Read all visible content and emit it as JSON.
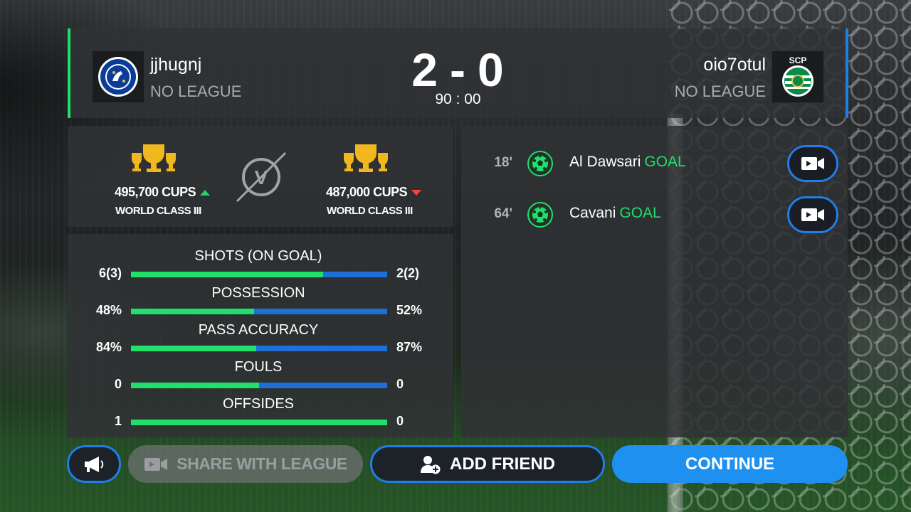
{
  "header": {
    "home": {
      "name": "jjhugnj",
      "league": "NO LEAGUE",
      "crest": "chelsea-crest"
    },
    "away": {
      "name": "oio7otul",
      "league": "NO LEAGUE",
      "crest": "sporting-crest"
    },
    "score_home": "2",
    "score_sep": "-",
    "score_away": "0",
    "time": "90 : 00",
    "home_color": "#1ee06a",
    "away_color": "#1f7ee8"
  },
  "cups": {
    "home": {
      "value": "495,700 CUPS",
      "rank": "WORLD CLASS III",
      "trend": "up"
    },
    "away": {
      "value": "487,000 CUPS",
      "rank": "WORLD CLASS III",
      "trend": "down"
    },
    "versus_label": "V"
  },
  "stats": [
    {
      "title": "SHOTS (ON GOAL)",
      "left": "6(3)",
      "right": "2(2)",
      "home_share": 0.75
    },
    {
      "title": "POSSESSION",
      "left": "48%",
      "right": "52%",
      "home_share": 0.48
    },
    {
      "title": "PASS ACCURACY",
      "left": "84%",
      "right": "87%",
      "home_share": 0.49
    },
    {
      "title": "FOULS",
      "left": "0",
      "right": "0",
      "home_share": 0.5
    },
    {
      "title": "OFFSIDES",
      "left": "1",
      "right": "0",
      "home_share": 1.0
    }
  ],
  "events": [
    {
      "minute": "18'",
      "player": "Al Dawsari",
      "type": "GOAL",
      "icon": "ball-icon"
    },
    {
      "minute": "64'",
      "player": "Cavani",
      "type": "GOAL",
      "icon": "ball-icon"
    }
  ],
  "buttons": {
    "share": "SHARE WITH LEAGUE",
    "add_friend": "ADD FRIEND",
    "continue": "CONTINUE"
  }
}
